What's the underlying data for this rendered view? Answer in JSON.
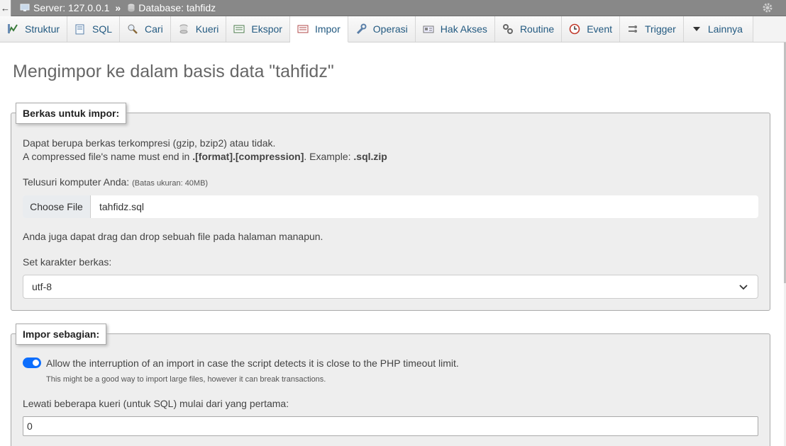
{
  "breadcrumb": {
    "back": "←",
    "server": "Server: 127.0.0.1",
    "sep": "»",
    "database": "Database: tahfidz",
    "server_icon": "server-icon",
    "database_icon": "database-icon",
    "settings_icon": "gear-icon"
  },
  "tabs": [
    {
      "label": "Struktur",
      "icon": "structure-icon"
    },
    {
      "label": "SQL",
      "icon": "sql-icon"
    },
    {
      "label": "Cari",
      "icon": "search-icon"
    },
    {
      "label": "Kueri",
      "icon": "query-icon"
    },
    {
      "label": "Ekspor",
      "icon": "export-icon"
    },
    {
      "label": "Impor",
      "icon": "import-icon",
      "active": true
    },
    {
      "label": "Operasi",
      "icon": "wrench-icon"
    },
    {
      "label": "Hak Akses",
      "icon": "privileges-icon"
    },
    {
      "label": "Routine",
      "icon": "routine-icon"
    },
    {
      "label": "Event",
      "icon": "clock-icon"
    },
    {
      "label": "Trigger",
      "icon": "trigger-icon"
    },
    {
      "label": "Lainnya",
      "icon": "chevron-down-icon"
    }
  ],
  "page_title": "Mengimpor ke dalam basis data \"tahfidz\"",
  "file_section": {
    "legend": "Berkas untuk impor:",
    "line1": "Dapat berupa berkas terkompresi (gzip, bzip2) atau tidak.",
    "line2_prefix": "A compressed file's name must end in ",
    "line2_bold": ".[format].[compression]",
    "line2_mid": ". Example: ",
    "line2_example": ".sql.zip",
    "browse_label": "Telusuri komputer Anda:",
    "browse_limit": "(Batas ukuran: 40MB)",
    "choose_button": "Choose File",
    "file_name": "tahfidz.sql",
    "drag_text": "Anda juga dapat drag dan drop sebuah file pada halaman manapun.",
    "charset_label": "Set karakter berkas:",
    "charset_value": "utf-8"
  },
  "partial_section": {
    "legend": "Impor sebagian:",
    "toggle_on": true,
    "toggle_label": "Allow the interruption of an import in case the script detects it is close to the PHP timeout limit.",
    "toggle_hint": "This might be a good way to import large files, however it can break transactions.",
    "skip_label": "Lewati beberapa kueri (untuk SQL) mulai dari yang pertama:",
    "skip_value": "0"
  },
  "colors": {
    "tab_text": "#235a81",
    "toggle": "#0d6efd",
    "crumb_bg": "#888888"
  }
}
